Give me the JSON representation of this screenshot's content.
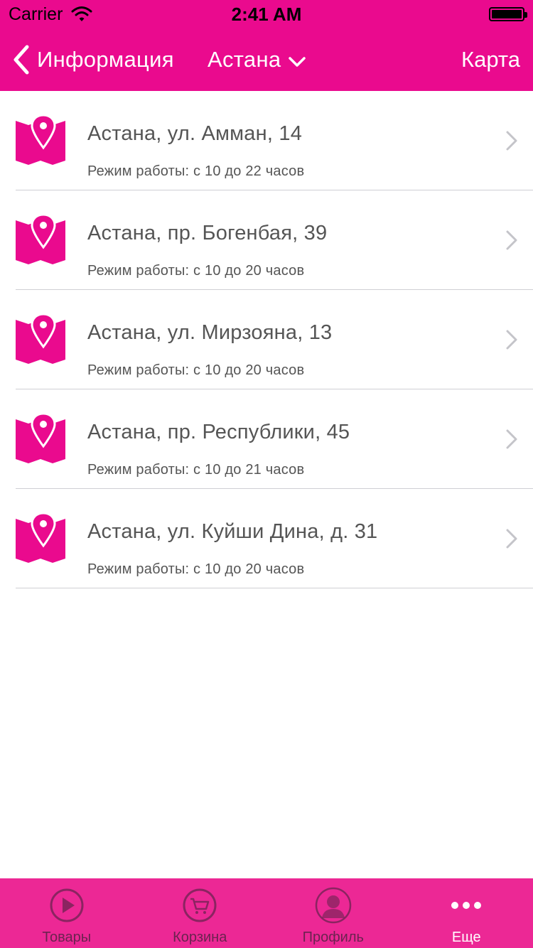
{
  "status_bar": {
    "carrier": "Carrier",
    "time": "2:41 AM"
  },
  "nav": {
    "back_label": "Информация",
    "city_label": "Астана",
    "map_label": "Карта"
  },
  "stores": [
    {
      "address": "Астана, ул. Амман, 14",
      "hours": "Режим работы: с 10 до 22 часов"
    },
    {
      "address": "Астана, пр. Богенбая, 39",
      "hours": "Режим работы: с 10 до 20 часов"
    },
    {
      "address": "Астана, ул. Мирзояна, 13",
      "hours": "Режим работы: с 10 до 20 часов"
    },
    {
      "address": "Астана, пр. Республики, 45",
      "hours": "Режим работы: с 10 до 21 часов"
    },
    {
      "address": "Астана, ул. Куйши Дина, д. 31",
      "hours": "Режим работы: с 10 до 20 часов"
    }
  ],
  "tabs": [
    {
      "label": "Товары",
      "icon": "play-icon"
    },
    {
      "label": "Корзина",
      "icon": "cart-icon"
    },
    {
      "label": "Профиль",
      "icon": "profile-icon"
    },
    {
      "label": "Еще",
      "icon": "more-icon"
    }
  ],
  "colors": {
    "brand": "#EA0A8E",
    "tab_bar": "#EC2895",
    "tab_inactive": "#6b2350",
    "text": "#555555"
  }
}
